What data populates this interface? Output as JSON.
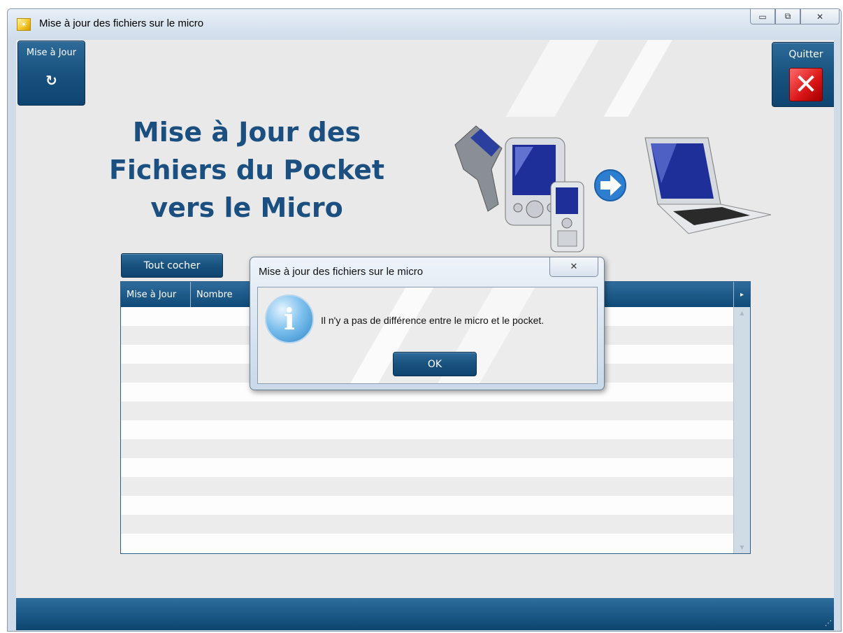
{
  "window": {
    "title": "Mise à jour des fichiers sur le micro",
    "minimize_glyph": "▭",
    "maximize_glyph": "⧉",
    "close_glyph": "✕",
    "app_icon": "sun-icon"
  },
  "toolbar": {
    "update_label": "Mise à Jour",
    "update_icon": "refresh-icon",
    "quit_label": "Quitter",
    "quit_icon": "close-x-icon"
  },
  "header": {
    "title_line1": "Mise à Jour des",
    "title_line2": "Fichiers du Pocket",
    "title_line3": "vers le Micro",
    "illustration": "pocket-to-laptop-sync-illustration"
  },
  "grid": {
    "check_all_label": "Tout cocher",
    "columns": [
      "Mise à Jour",
      "Nombre"
    ],
    "scroll_right_glyph": "▸",
    "row_count": 13
  },
  "dialog": {
    "title": "Mise à jour des fichiers sur le micro",
    "close_glyph": "✕",
    "message": "Il n'y a pas de différence entre le micro et le pocket.",
    "ok_label": "OK",
    "icon": "info-icon"
  },
  "colors": {
    "accent": "#18527e",
    "title_text": "#1a4f80",
    "client_bg": "#e9e9e9"
  }
}
